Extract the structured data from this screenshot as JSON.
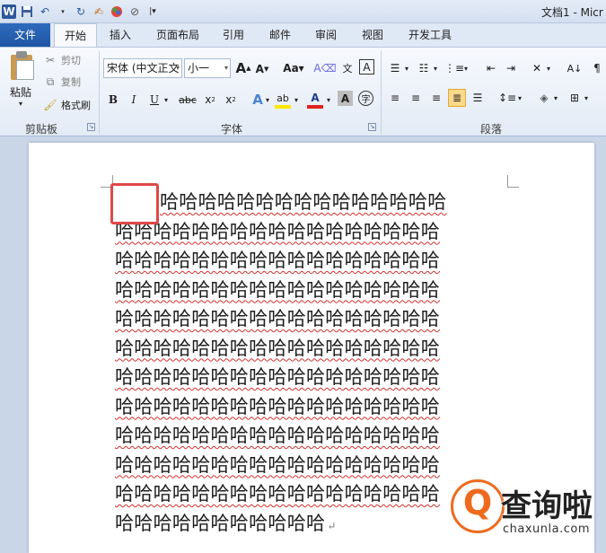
{
  "window": {
    "title": "文档1 - Micr"
  },
  "qat": {
    "icons": [
      "word-logo",
      "save-icon",
      "undo-icon",
      "redo-icon",
      "paint-icon",
      "color-icon",
      "customize-icon"
    ]
  },
  "tabs": [
    {
      "label": "文件"
    },
    {
      "label": "开始"
    },
    {
      "label": "插入"
    },
    {
      "label": "页面布局"
    },
    {
      "label": "引用"
    },
    {
      "label": "邮件"
    },
    {
      "label": "审阅"
    },
    {
      "label": "视图"
    },
    {
      "label": "开发工具"
    }
  ],
  "clipboard": {
    "paste": "粘贴",
    "cut": "剪切",
    "copy": "复制",
    "format_painter": "格式刷",
    "label": "剪贴板"
  },
  "font": {
    "name": "宋体 (中文正文",
    "size": "小一",
    "label": "字体",
    "grow": "A",
    "shrink": "A",
    "case": "Aa"
  },
  "paragraph": {
    "label": "段落"
  },
  "document": {
    "lines": [
      "哈哈哈哈哈哈哈哈哈哈哈哈哈哈哈",
      "哈哈哈哈哈哈哈哈哈哈哈哈哈哈哈哈哈",
      "哈哈哈哈哈哈哈哈哈哈哈哈哈哈哈哈哈",
      "哈哈哈哈哈哈哈哈哈哈哈哈哈哈哈哈哈",
      "哈哈哈哈哈哈哈哈哈哈哈哈哈哈哈哈哈",
      "哈哈哈哈哈哈哈哈哈哈哈哈哈哈哈哈哈",
      "哈哈哈哈哈哈哈哈哈哈哈哈哈哈哈哈哈",
      "哈哈哈哈哈哈哈哈哈哈哈哈哈哈哈哈哈",
      "哈哈哈哈哈哈哈哈哈哈哈哈哈哈哈哈哈",
      "哈哈哈哈哈哈哈哈哈哈哈哈哈哈哈哈哈",
      "哈哈哈哈哈哈哈哈哈哈哈哈哈哈哈哈哈",
      "哈哈哈哈哈哈哈哈哈哈哈"
    ],
    "paragraph_mark": "↵"
  },
  "watermark": {
    "main": "查询啦",
    "sub": "chaxunla.com",
    "logo_letter": "Q"
  },
  "colors": {
    "file_tab": "#1d55a3",
    "highlight": "#e04848",
    "watermark_accent": "#ee6a1e"
  }
}
